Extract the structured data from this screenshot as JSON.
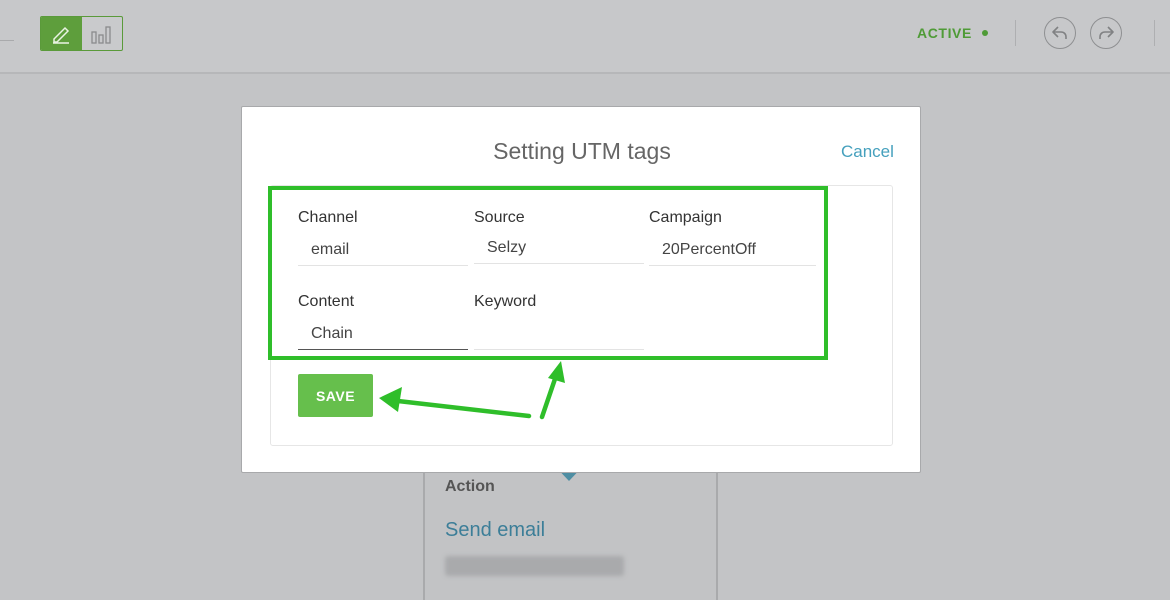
{
  "toolbar": {
    "status_label": "ACTIVE",
    "icons": [
      "edit-pencil-icon",
      "statistics-bars-icon",
      "undo-icon",
      "redo-icon"
    ],
    "accent_color": "#4f9b37"
  },
  "background_node": {
    "title": "Action",
    "link": "Send email"
  },
  "modal": {
    "title": "Setting UTM tags",
    "cancel_label": "Cancel",
    "fields": {
      "channel": {
        "label": "Channel",
        "value": "email"
      },
      "source": {
        "label": "Source",
        "value": "Selzy"
      },
      "campaign": {
        "label": "Campaign",
        "value": "20PercentOff"
      },
      "content": {
        "label": "Content",
        "value": "Chain"
      },
      "keyword": {
        "label": "Keyword",
        "value": ""
      }
    },
    "save_label": "SAVE",
    "highlight_color": "#2fbe2a",
    "save_color": "#66bf4c"
  }
}
